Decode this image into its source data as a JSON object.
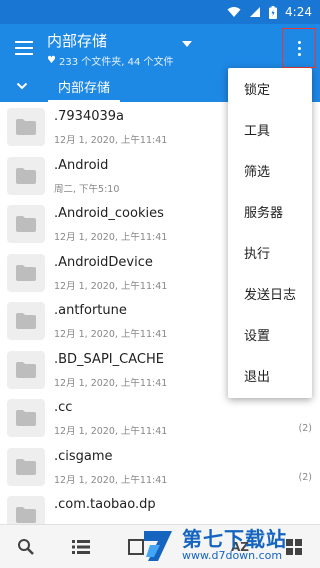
{
  "status_bar": {
    "time": "4:24"
  },
  "app_bar": {
    "title": "内部存储",
    "subtitle": "233 个文件夹, 44 个文件"
  },
  "tabs": [
    {
      "label": "内部存储"
    }
  ],
  "files": [
    {
      "name": ".7934039a",
      "date": "12月 1, 2020, 上午11:41",
      "count": ""
    },
    {
      "name": ".Android",
      "date": "周二, 下午5:10",
      "count": ""
    },
    {
      "name": ".Android_cookies",
      "date": "12月 1, 2020, 上午11:41",
      "count": ""
    },
    {
      "name": ".AndroidDevice",
      "date": "12月 1, 2020, 上午11:41",
      "count": ""
    },
    {
      "name": ".antfortune",
      "date": "12月 1, 2020, 上午11:41",
      "count": ""
    },
    {
      "name": ".BD_SAPI_CACHE",
      "date": "12月 1, 2020, 上午11:41",
      "count": ""
    },
    {
      "name": ".cc",
      "date": "12月 1, 2020, 上午11:41",
      "count": "(2)"
    },
    {
      "name": ".cisgame",
      "date": "12月 1, 2020, 上午11:41",
      "count": "(2)"
    },
    {
      "name": ".com.taobao.dp",
      "date": "",
      "count": ""
    }
  ],
  "menu": {
    "items": [
      {
        "label": "锁定"
      },
      {
        "label": "工具"
      },
      {
        "label": "筛选"
      },
      {
        "label": "服务器"
      },
      {
        "label": "执行"
      },
      {
        "label": "发送日志"
      },
      {
        "label": "设置"
      },
      {
        "label": "退出"
      }
    ]
  },
  "bottom_bar": {
    "sort_label": "AZ"
  },
  "watermark": {
    "name": "第七下载站",
    "url": "www.d7down.com"
  },
  "icons": {
    "menu": "hamburger-icon",
    "dropdown": "triangle-down-icon",
    "overflow": "more-vert-icon",
    "heart": "heart-icon",
    "folder": "folder-icon",
    "search": "search-icon",
    "list": "list-view-icon"
  },
  "colors": {
    "app_bar": "#1e88e5",
    "status_bar": "#1976d2",
    "highlight": "#e53935",
    "watermark": "#1565c0"
  }
}
